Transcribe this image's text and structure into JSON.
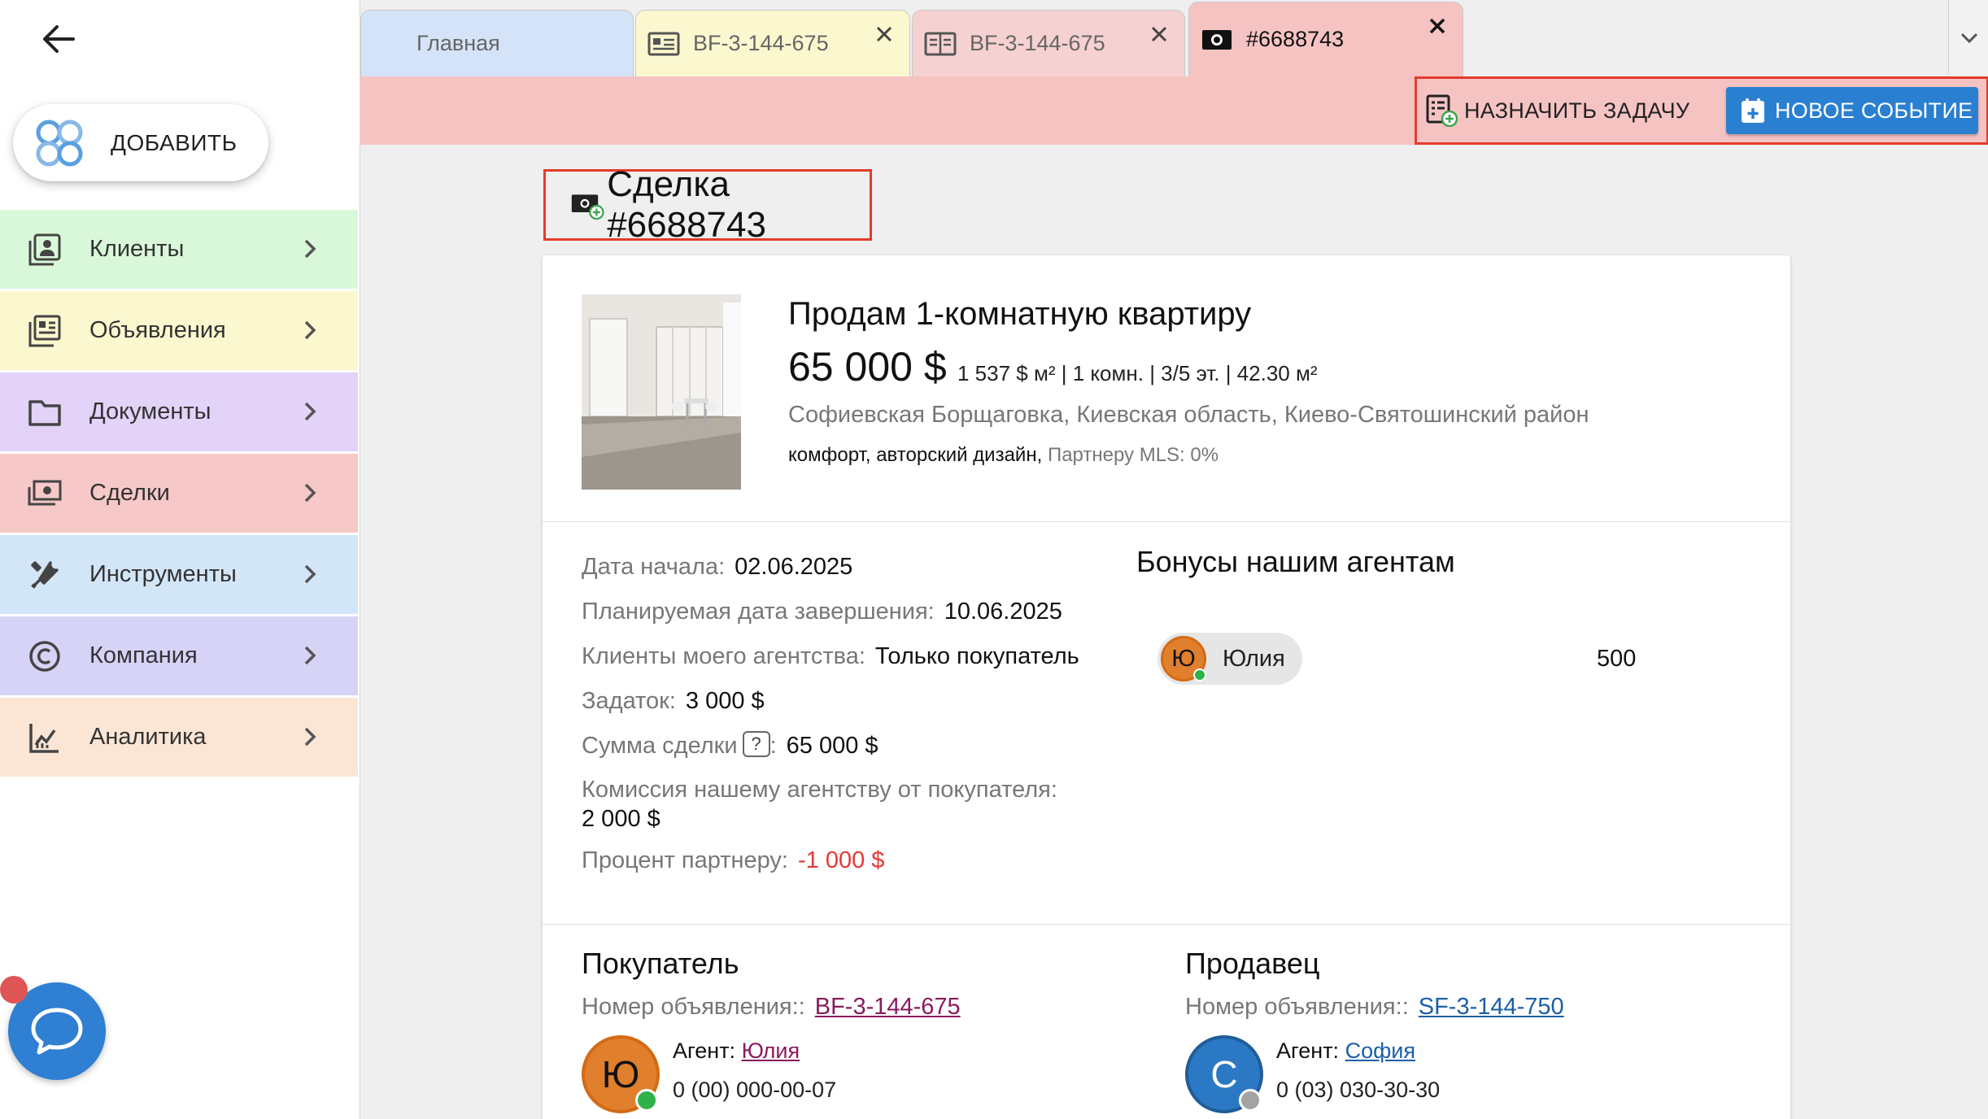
{
  "sidebar": {
    "add_label": "ДОБАВИТЬ",
    "items": [
      {
        "label": "Клиенты",
        "color": "#d9f8d9",
        "icon": "contacts-icon"
      },
      {
        "label": "Объявления",
        "color": "#fbf8cf",
        "icon": "listings-icon"
      },
      {
        "label": "Документы",
        "color": "#e3d3f8",
        "icon": "folder-icon"
      },
      {
        "label": "Сделки",
        "color": "#f6c8c8",
        "icon": "cash-icon"
      },
      {
        "label": "Инструменты",
        "color": "#d3e6f8",
        "icon": "tools-icon"
      },
      {
        "label": "Компания",
        "color": "#d6d3f7",
        "icon": "copyright-icon"
      },
      {
        "label": "Аналитика",
        "color": "#fbe6d6",
        "icon": "analytics-icon"
      }
    ]
  },
  "tabs": [
    {
      "label": "Главная"
    },
    {
      "label": "BF-3-144-675"
    },
    {
      "label": "BF-3-144-675"
    },
    {
      "label": "#6688743"
    }
  ],
  "toolbar": {
    "assign_label": "НАЗНАЧИТЬ ЗАДАЧУ",
    "new_event_label": "НОВОЕ СОБЫТИЕ"
  },
  "deal": {
    "title": "Сделка #6688743"
  },
  "listing": {
    "title": "Продам 1-комнатную квартиру",
    "price": "65 000 $",
    "stats": "1 537 $ м² | 1 комн. | 3/5 эт. | 42.30 м²",
    "address": "Софиевская Борщаговка, Киевская область, Киево-Святошинский район",
    "features": "комфорт, авторский дизайн,",
    "mls": "Партнеру MLS: 0%"
  },
  "details": {
    "start_label": "Дата начала:",
    "start_value": "02.06.2025",
    "planned_label": "Планируемая дата завершения:",
    "planned_value": "10.06.2025",
    "clients_label": "Клиенты моего агентства:",
    "clients_value": "Только покупатель",
    "deposit_label": "Задаток:",
    "deposit_value": "3 000 $",
    "sum_label": "Сумма сделки",
    "sum_help": "?",
    "sum_colon": ":",
    "sum_value": "65 000 $",
    "commission_label": "Комиссия нашему агентству от покупателя:",
    "commission_value": "2 000 $",
    "partner_label": "Процент партнеру:",
    "partner_value": "-1 000 $"
  },
  "bonuses": {
    "title": "Бонусы нашим агентам",
    "agent_initial": "Ю",
    "agent_name": "Юлия",
    "amount": "500"
  },
  "buyer": {
    "title": "Покупатель",
    "num_label": "Номер объявления::",
    "num_value": "BF-3-144-675",
    "avatar": "Ю",
    "agent_label": "Агент:",
    "agent_name": "Юлия",
    "phone": "0 (00) 000-00-07"
  },
  "seller": {
    "title": "Продавец",
    "num_label": "Номер объявления::",
    "num_value": "SF-3-144-750",
    "avatar": "С",
    "agent_label": "Агент:",
    "agent_name": "София",
    "phone": "0 (03) 030-30-30"
  }
}
